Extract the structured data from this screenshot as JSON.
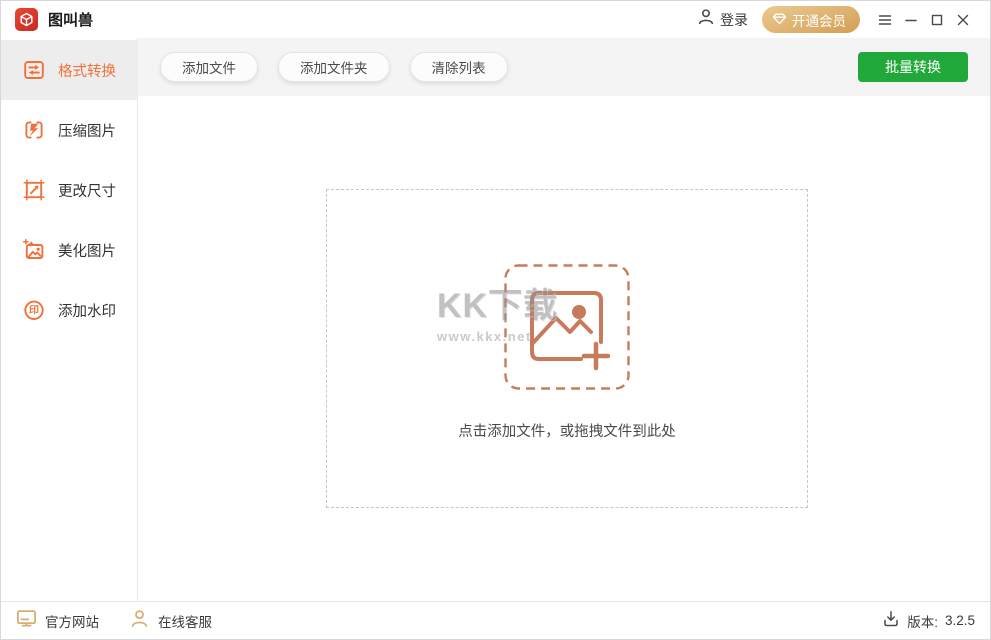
{
  "titlebar": {
    "app_title": "图叫兽",
    "login_label": "登录",
    "vip_label": "开通会员"
  },
  "sidebar": {
    "items": [
      {
        "label": "格式转换",
        "active": true,
        "icon": "format-convert-icon"
      },
      {
        "label": "压缩图片",
        "active": false,
        "icon": "compress-image-icon"
      },
      {
        "label": "更改尺寸",
        "active": false,
        "icon": "resize-icon"
      },
      {
        "label": "美化图片",
        "active": false,
        "icon": "beautify-image-icon"
      },
      {
        "label": "添加水印",
        "active": false,
        "icon": "watermark-stamp-icon",
        "icon_glyph": "印"
      }
    ]
  },
  "toolbar": {
    "add_file_label": "添加文件",
    "add_folder_label": "添加文件夹",
    "clear_list_label": "清除列表",
    "batch_convert_label": "批量转换"
  },
  "dropzone": {
    "hint": "点击添加文件，或拖拽文件到此处"
  },
  "watermark": {
    "text": "KK下载",
    "url": "www.kkx.net"
  },
  "footer": {
    "website_label": "官方网站",
    "support_label": "在线客服",
    "version_label": "版本:",
    "version_value": "3.2.5"
  },
  "colors": {
    "accent_orange": "#F1713B",
    "convert_green": "#21A83B",
    "vip_gold": "#D8A75D",
    "dropzone_icon_salmon": "#C87B5C",
    "footer_icon_tan": "#D8AE6F"
  }
}
